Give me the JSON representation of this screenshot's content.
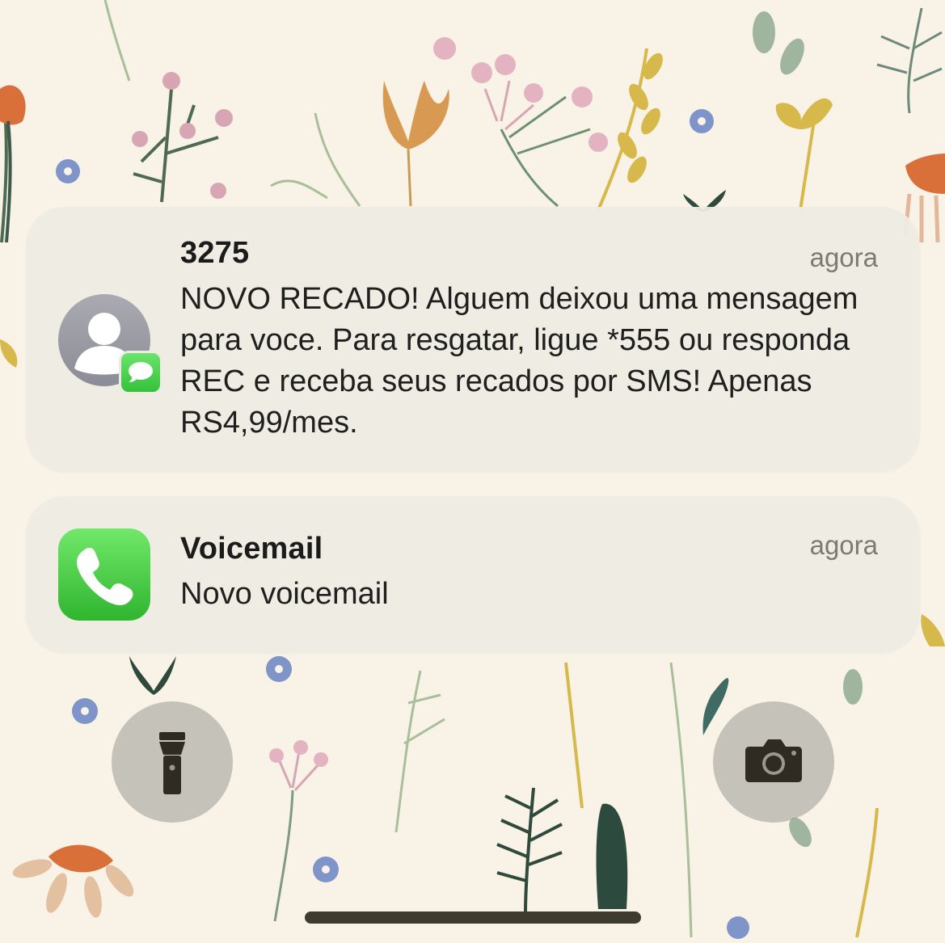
{
  "notifications": [
    {
      "app": "Messages",
      "sender": "3275",
      "time": "agora",
      "body": "NOVO RECADO! Alguem deixou uma mensagem para voce. Para resgatar, ligue *555 ou responda REC e receba seus recados por SMS! Apenas RS4,99/mes.",
      "icon": "contact-avatar-icon",
      "badge_icon": "messages-badge-icon"
    },
    {
      "app": "Phone",
      "sender": "Voicemail",
      "time": "agora",
      "body": "Novo voicemail",
      "icon": "phone-app-icon"
    }
  ],
  "lockscreen": {
    "left_button_icon": "flashlight-icon",
    "right_button_icon": "camera-icon"
  },
  "colors": {
    "wallpaper_bg": "#f8f3e6",
    "notification_bg": "#eeece2",
    "messages_green": "#35c13a",
    "phone_green": "#2fb52f",
    "secondary_text": "#7d7a72"
  }
}
